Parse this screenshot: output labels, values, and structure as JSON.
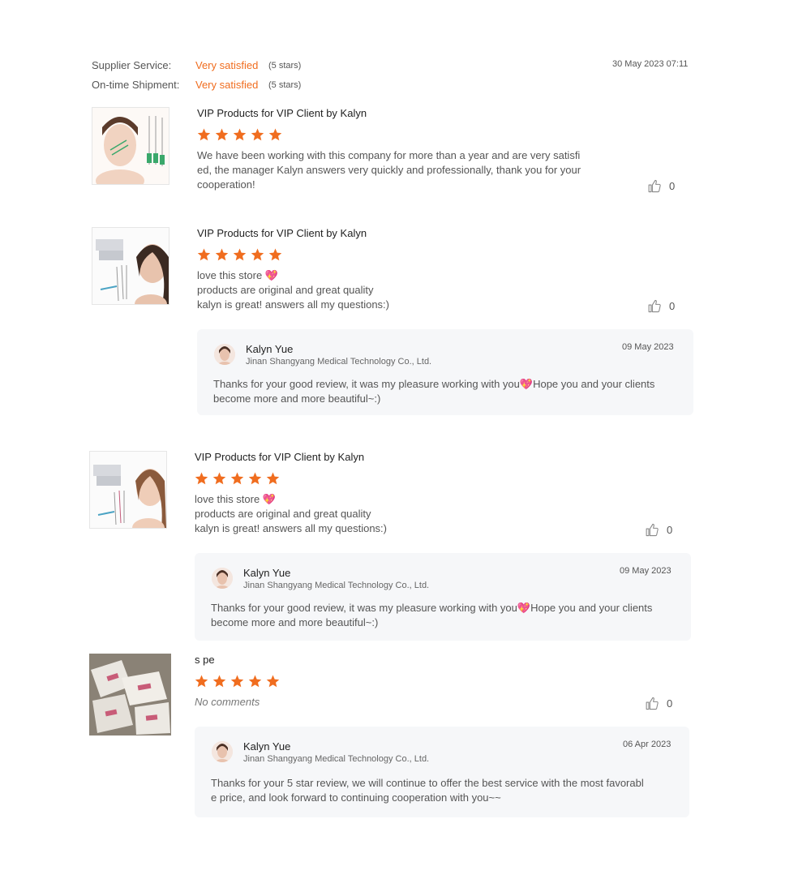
{
  "ratings": {
    "supplier_label": "Supplier Service:",
    "supplier_value": "Very satisfied",
    "supplier_stars": "(5 stars)",
    "shipment_label": "On-time Shipment:",
    "shipment_value": "Very satisfied",
    "shipment_stars": "(5 stars)",
    "date": "30 May 2023 07:11"
  },
  "reviews": [
    {
      "title": "VIP Products for VIP Client by Kalyn",
      "stars": 5,
      "body_lines": [
        "We have been working with this company for more than a year and are very satisfi",
        "ed, the manager Kalyn answers very quickly and professionally, thank you for your",
        "cooperation!"
      ],
      "likes": "0"
    },
    {
      "title": "VIP Products for VIP Client by Kalyn",
      "stars": 5,
      "body_lines": [
        "love this store 💖",
        "products are original and great quality",
        "kalyn is great! answers all my questions:)"
      ],
      "likes": "0",
      "reply": {
        "name": "Kalyn Yue",
        "company": "Jinan Shangyang Medical Technology Co., Ltd.",
        "date": "09 May 2023",
        "lines": [
          "Thanks for your good review, it was my pleasure working with you💖Hope you and your clients",
          "become more and more beautiful~:)"
        ]
      }
    },
    {
      "title": "VIP Products for VIP Client by Kalyn",
      "stars": 5,
      "body_lines": [
        "love this store 💖",
        "products are original and great quality",
        "kalyn is great! answers all my questions:)"
      ],
      "likes": "0",
      "reply": {
        "name": "Kalyn Yue",
        "company": "Jinan Shangyang Medical Technology Co., Ltd.",
        "date": "09 May 2023",
        "lines": [
          "Thanks for your good review, it was my pleasure working with you💖Hope you and your clients",
          "become more and more beautiful~:)"
        ]
      }
    },
    {
      "title": "s pe",
      "stars": 5,
      "no_comments": "No comments",
      "likes": "0",
      "reply": {
        "name": "Kalyn Yue",
        "company": "Jinan Shangyang Medical Technology Co., Ltd.",
        "date": "06 Apr 2023",
        "lines": [
          "Thanks for your 5 star review, we will continue to offer the best service with the most favorabl",
          "e price, and look forward to continuing cooperation with you~~"
        ]
      }
    }
  ],
  "icons": {
    "star": "star-icon",
    "like": "thumbs-up-icon",
    "avatar": "avatar"
  },
  "colors": {
    "accent": "#f06d1f",
    "reply_bg": "#f6f7f9"
  }
}
